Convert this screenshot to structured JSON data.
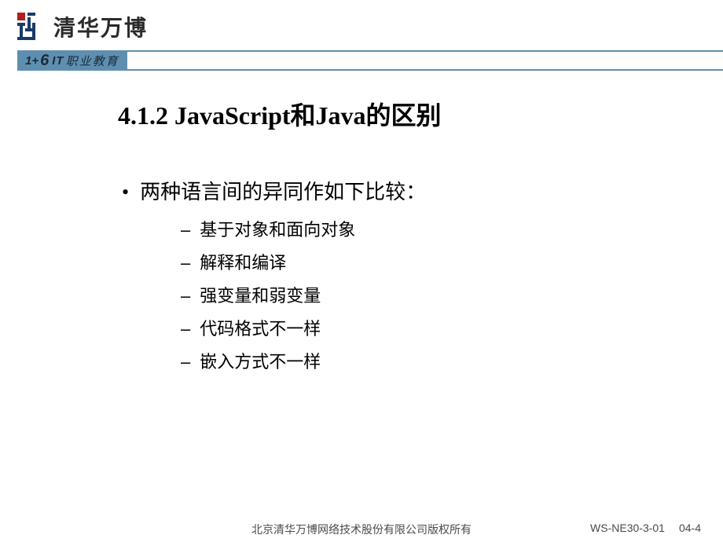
{
  "header": {
    "logo_text": "清华万博",
    "sub_brand_one": "1",
    "sub_brand_plus": "+",
    "sub_brand_six": "6",
    "sub_brand_it": "IT",
    "sub_brand_edu": "职业教育"
  },
  "slide": {
    "title": "4.1.2 JavaScript和Java的区别",
    "main_bullet": "两种语言间的异同作如下比较：",
    "sub_bullets": [
      "基于对象和面向对象",
      "解释和编译",
      "强变量和弱变量",
      "代码格式不一样",
      "嵌入方式不一样"
    ]
  },
  "footer": {
    "copyright": "北京清华万博网络技术股份有限公司版权所有",
    "doc_code": "WS-NE30-3-01",
    "page": "04-4"
  }
}
